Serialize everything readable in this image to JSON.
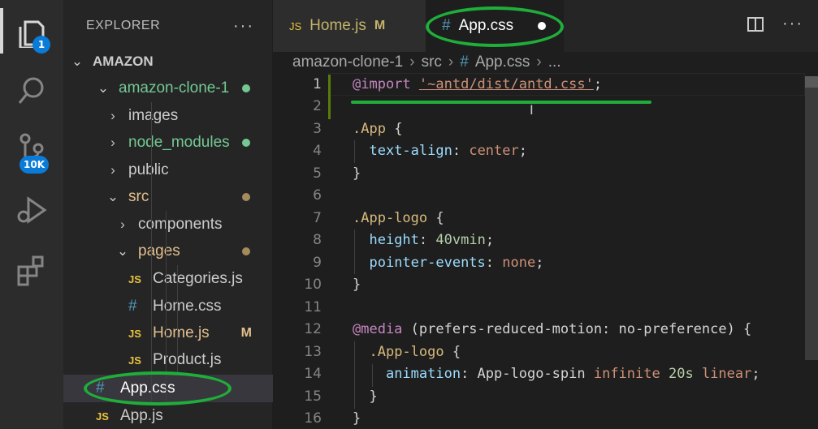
{
  "activity_bar": {
    "explorer_badge": "1",
    "source_control_badge": "10K"
  },
  "sidebar": {
    "title": "EXPLORER",
    "more": "···",
    "root": "AMAZON",
    "items": [
      {
        "label": "amazon-clone-1",
        "type": "folder-open",
        "color": "#73c991",
        "dot": "#73c991"
      },
      {
        "label": "images",
        "type": "folder-closed",
        "color": "#cccccc"
      },
      {
        "label": "node_modules",
        "type": "folder-closed",
        "color": "#73c991",
        "dot": "#73c991"
      },
      {
        "label": "public",
        "type": "folder-closed",
        "color": "#cccccc"
      },
      {
        "label": "src",
        "type": "folder-open",
        "color": "#e2c08d",
        "dot": "#a58a5c"
      },
      {
        "label": "components",
        "type": "folder-closed",
        "color": "#cccccc"
      },
      {
        "label": "pages",
        "type": "folder-open",
        "color": "#e2c08d",
        "dot": "#a58a5c"
      },
      {
        "label": "Categories.js",
        "type": "js",
        "color": "#cccccc"
      },
      {
        "label": "Home.css",
        "type": "css",
        "color": "#cccccc"
      },
      {
        "label": "Home.js",
        "type": "js",
        "color": "#e2c08d",
        "mark": "M"
      },
      {
        "label": "Product.js",
        "type": "js",
        "color": "#cccccc"
      },
      {
        "label": "App.css",
        "type": "css",
        "color": "#ffffff",
        "selected": true
      },
      {
        "label": "App.js",
        "type": "js",
        "color": "#cccccc"
      }
    ]
  },
  "tabs": [
    {
      "icon": "JS",
      "label": "Home.js",
      "mark": "M"
    },
    {
      "icon": "#",
      "label": "App.css",
      "active": true
    }
  ],
  "breadcrumb": [
    "amazon-clone-1",
    "src",
    "App.css",
    "..."
  ],
  "icons": {
    "js": "JS",
    "css": "#",
    "chevron_down": "⌄",
    "chevron_right": "›",
    "ibeam": "I"
  },
  "editor": {
    "lines": [
      {
        "n": "1",
        "code": [
          [
            "k-at",
            "@import"
          ],
          [
            "k-plain",
            " "
          ],
          [
            "k-str",
            "'~antd/dist/antd.css'"
          ],
          [
            "k-plain",
            ";"
          ]
        ]
      },
      {
        "n": "2",
        "code": []
      },
      {
        "n": "3",
        "code": [
          [
            "k-sel",
            ".App"
          ],
          [
            "k-plain",
            " {"
          ]
        ]
      },
      {
        "n": "4",
        "code": [
          [
            "k-plain",
            "  "
          ],
          [
            "k-prop",
            "text-align"
          ],
          [
            "k-plain",
            ": "
          ],
          [
            "k-val",
            "center"
          ],
          [
            "k-plain",
            ";"
          ]
        ]
      },
      {
        "n": "5",
        "code": [
          [
            "k-plain",
            "}"
          ]
        ]
      },
      {
        "n": "6",
        "code": []
      },
      {
        "n": "7",
        "code": [
          [
            "k-sel",
            ".App-logo"
          ],
          [
            "k-plain",
            " {"
          ]
        ]
      },
      {
        "n": "8",
        "code": [
          [
            "k-plain",
            "  "
          ],
          [
            "k-prop",
            "height"
          ],
          [
            "k-plain",
            ": "
          ],
          [
            "k-num",
            "40vmin"
          ],
          [
            "k-plain",
            ";"
          ]
        ]
      },
      {
        "n": "9",
        "code": [
          [
            "k-plain",
            "  "
          ],
          [
            "k-prop",
            "pointer-events"
          ],
          [
            "k-plain",
            ": "
          ],
          [
            "k-val",
            "none"
          ],
          [
            "k-plain",
            ";"
          ]
        ]
      },
      {
        "n": "10",
        "code": [
          [
            "k-plain",
            "}"
          ]
        ]
      },
      {
        "n": "11",
        "code": []
      },
      {
        "n": "12",
        "code": [
          [
            "k-at",
            "@media"
          ],
          [
            "k-plain",
            " (prefers-reduced-motion: no-preference) {"
          ]
        ]
      },
      {
        "n": "13",
        "code": [
          [
            "k-plain",
            "  "
          ],
          [
            "k-sel",
            ".App-logo"
          ],
          [
            "k-plain",
            " {"
          ]
        ]
      },
      {
        "n": "14",
        "code": [
          [
            "k-plain",
            "    "
          ],
          [
            "k-prop",
            "animation"
          ],
          [
            "k-plain",
            ": App-logo-spin "
          ],
          [
            "k-val",
            "infinite"
          ],
          [
            "k-plain",
            " "
          ],
          [
            "k-num",
            "20s"
          ],
          [
            "k-plain",
            " "
          ],
          [
            "k-val",
            "linear"
          ],
          [
            "k-plain",
            ";"
          ]
        ]
      },
      {
        "n": "15",
        "code": [
          [
            "k-plain",
            "  }"
          ]
        ]
      },
      {
        "n": "16",
        "code": [
          [
            "k-plain",
            "}"
          ]
        ]
      }
    ]
  }
}
